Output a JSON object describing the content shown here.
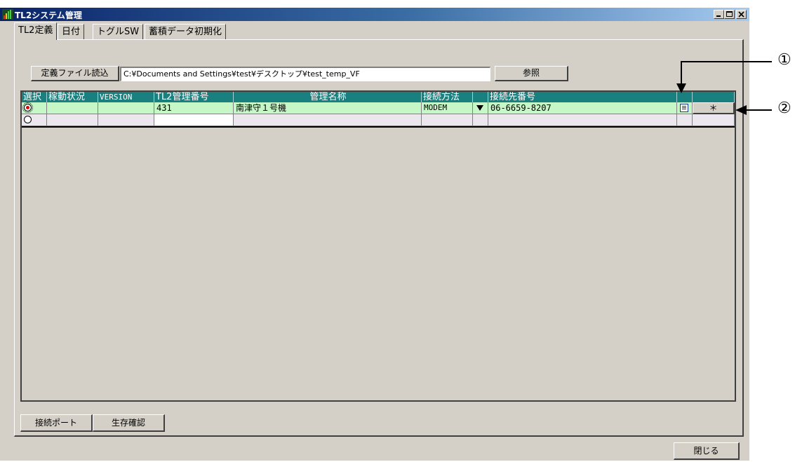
{
  "window": {
    "title": "TL2システム管理"
  },
  "tabs": [
    {
      "label": "TL2定義",
      "active": true
    },
    {
      "label": "日付"
    },
    {
      "label": "トグルSW"
    },
    {
      "label": "蓄積データ初期化"
    }
  ],
  "definition": {
    "load_button": "定義ファイル読込",
    "path_value": "C:¥Documents and Settings¥test¥デスクトップ¥test_temp_VF",
    "browse_button": "参照"
  },
  "grid": {
    "headers": [
      "選択",
      "稼動状況",
      "VERSION",
      "TL2管理番号",
      "管理名称",
      "接続方法",
      "",
      "接続先番号",
      "",
      ""
    ],
    "rows": [
      {
        "selected": true,
        "status": "",
        "version": "",
        "number": "431",
        "name": "南津守１号機",
        "method": "MODEM",
        "phone": "06-6659-8207",
        "action": "＊"
      },
      {
        "selected": false,
        "status": "",
        "version": "",
        "number": "",
        "name": "",
        "method": "",
        "phone": "",
        "action": ""
      }
    ]
  },
  "bottom": {
    "port_button": "接続ポート",
    "alive_button": "生存確認",
    "close_button": "閉じる"
  },
  "annotations": [
    "①",
    "②"
  ],
  "colors": {
    "header_bg": "#1a7f7f",
    "selected_row": "#c6f7c6",
    "empty_row": "#ece7ee",
    "radio_on": "#e00000"
  }
}
